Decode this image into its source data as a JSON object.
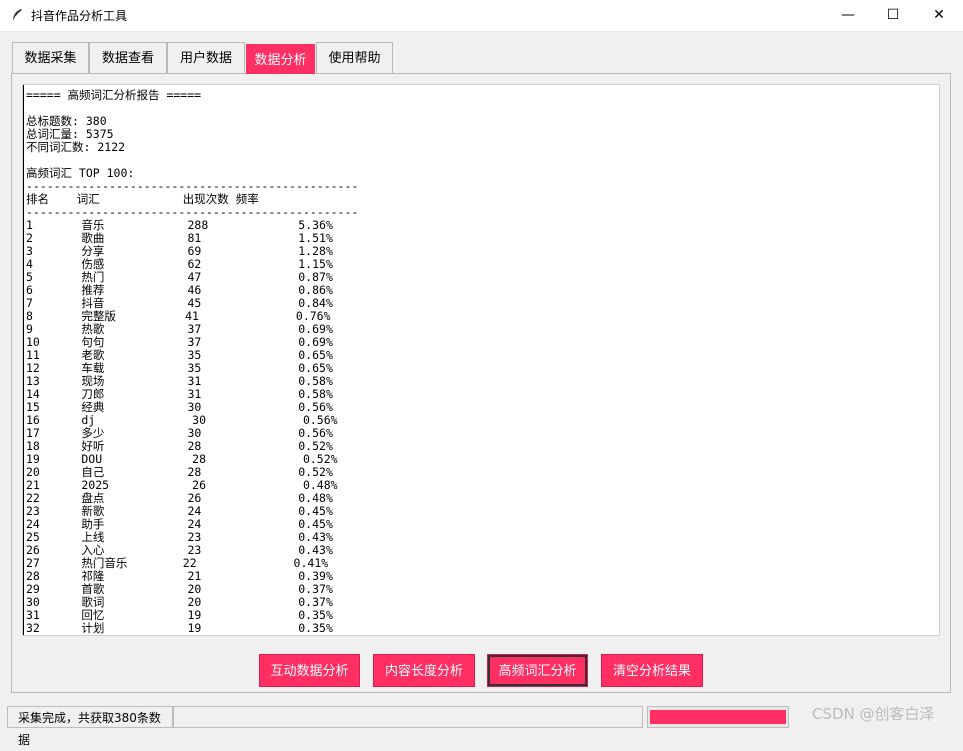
{
  "window": {
    "title": "抖音作品分析工具",
    "minimize": "—",
    "maximize": "☐",
    "close": "✕"
  },
  "tabs": [
    {
      "label": "数据采集",
      "active": false
    },
    {
      "label": "数据查看",
      "active": false
    },
    {
      "label": "用户数据",
      "active": false
    },
    {
      "label": "数据分析",
      "active": true
    },
    {
      "label": "使用帮助",
      "active": false
    }
  ],
  "report": {
    "header": "===== 高频词汇分析报告 =====",
    "stats": [
      "总标题数: 380",
      "总词汇量: 5375",
      "不同词汇数: 2122"
    ],
    "top_title": "高频词汇 TOP 100:",
    "columns": [
      "排名",
      "词汇",
      "出现次数",
      "频率"
    ],
    "rows": [
      [
        "1",
        "音乐",
        "288",
        "5.36%"
      ],
      [
        "2",
        "歌曲",
        "81",
        "1.51%"
      ],
      [
        "3",
        "分享",
        "69",
        "1.28%"
      ],
      [
        "4",
        "伤感",
        "62",
        "1.15%"
      ],
      [
        "5",
        "热门",
        "47",
        "0.87%"
      ],
      [
        "6",
        "推荐",
        "46",
        "0.86%"
      ],
      [
        "7",
        "抖音",
        "45",
        "0.84%"
      ],
      [
        "8",
        "完整版",
        "41",
        "0.76%"
      ],
      [
        "9",
        "热歌",
        "37",
        "0.69%"
      ],
      [
        "10",
        "句句",
        "37",
        "0.69%"
      ],
      [
        "11",
        "老歌",
        "35",
        "0.65%"
      ],
      [
        "12",
        "车载",
        "35",
        "0.65%"
      ],
      [
        "13",
        "现场",
        "31",
        "0.58%"
      ],
      [
        "14",
        "刀郎",
        "31",
        "0.58%"
      ],
      [
        "15",
        "经典",
        "30",
        "0.56%"
      ],
      [
        "16",
        "dj",
        "30",
        "0.56%"
      ],
      [
        "17",
        "多少",
        "30",
        "0.56%"
      ],
      [
        "18",
        "好听",
        "28",
        "0.52%"
      ],
      [
        "19",
        "DOU",
        "28",
        "0.52%"
      ],
      [
        "20",
        "自己",
        "28",
        "0.52%"
      ],
      [
        "21",
        "2025",
        "26",
        "0.48%"
      ],
      [
        "22",
        "盘点",
        "26",
        "0.48%"
      ],
      [
        "23",
        "新歌",
        "24",
        "0.45%"
      ],
      [
        "24",
        "助手",
        "24",
        "0.45%"
      ],
      [
        "25",
        "上线",
        "23",
        "0.43%"
      ],
      [
        "26",
        "入心",
        "23",
        "0.43%"
      ],
      [
        "27",
        "热门音乐",
        "22",
        "0.41%"
      ],
      [
        "28",
        "祁隆",
        "21",
        "0.39%"
      ],
      [
        "29",
        "首歌",
        "20",
        "0.37%"
      ],
      [
        "30",
        "歌词",
        "20",
        "0.37%"
      ],
      [
        "31",
        "回忆",
        "19",
        "0.35%"
      ],
      [
        "32",
        "计划",
        "19",
        "0.35%"
      ]
    ]
  },
  "buttons": [
    {
      "label": "互动数据分析",
      "name": "interaction-analysis-button"
    },
    {
      "label": "内容长度分析",
      "name": "content-length-analysis-button"
    },
    {
      "label": "高频词汇分析",
      "name": "high-frequency-words-button"
    },
    {
      "label": "清空分析结果",
      "name": "clear-results-button"
    }
  ],
  "status": {
    "text": "采集完成，共获取380条数据",
    "progress_percent": 100
  },
  "watermark": "CSDN @创客白泽",
  "colors": {
    "accent": "#ff2e63"
  }
}
